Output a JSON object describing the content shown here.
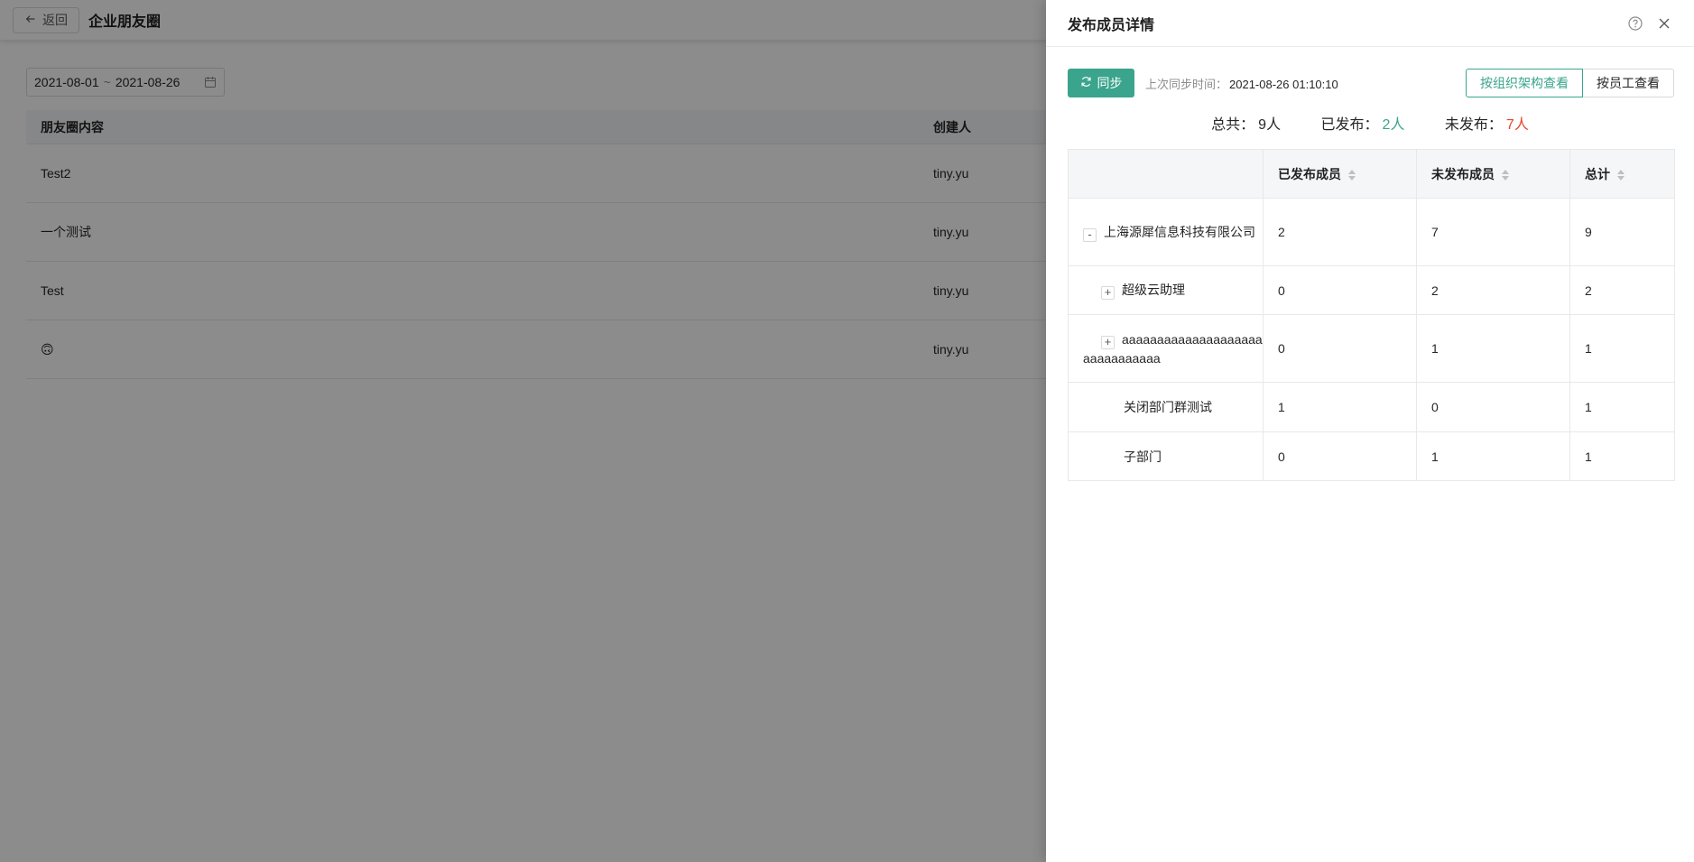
{
  "background": {
    "back_label": "返回",
    "page_title": "企业朋友圈",
    "date_start": "2021-08-01",
    "date_sep": "~",
    "date_end": "2021-08-26",
    "table": {
      "headers": [
        "朋友圈内容",
        "创建人"
      ],
      "rows": [
        {
          "content": "Test2",
          "creator": "tiny.yu"
        },
        {
          "content": "一个测试",
          "creator": "tiny.yu"
        },
        {
          "content": "Test",
          "creator": "tiny.yu"
        },
        {
          "content": "🙃",
          "creator": "tiny.yu"
        }
      ]
    }
  },
  "drawer": {
    "title": "发布成员详情",
    "sync_label": "同步",
    "sync_prefix": "上次同步时间：",
    "sync_time": "2021-08-26 01:10:10",
    "view_org": "按组织架构查看",
    "view_staff": "按员工查看",
    "summary": {
      "total_label": "总共：",
      "total_value": "9人",
      "published_label": "已发布：",
      "published_value": "2人",
      "unpublished_label": "未发布：",
      "unpublished_value": "7人"
    },
    "table": {
      "headers": [
        "",
        "已发布成员",
        "未发布成员",
        "总计"
      ],
      "rows": [
        {
          "expander": "-",
          "name": "上海源犀信息科技有限公司",
          "published": "2",
          "unpublished": "7",
          "total": "9"
        },
        {
          "expander": "+",
          "name": "超级云助理",
          "published": "0",
          "unpublished": "2",
          "total": "2"
        },
        {
          "expander": "+",
          "name": "aaaaaaaaaaaaaaaaaaaaaaaaaaaaaaa",
          "published": "0",
          "unpublished": "1",
          "total": "1"
        },
        {
          "expander": "",
          "name": "关闭部门群测试",
          "published": "1",
          "unpublished": "0",
          "total": "1"
        },
        {
          "expander": "",
          "name": "子部门",
          "published": "0",
          "unpublished": "1",
          "total": "1"
        }
      ]
    },
    "colors": {
      "accent": "#3aa48c",
      "danger": "#e8452c"
    }
  }
}
